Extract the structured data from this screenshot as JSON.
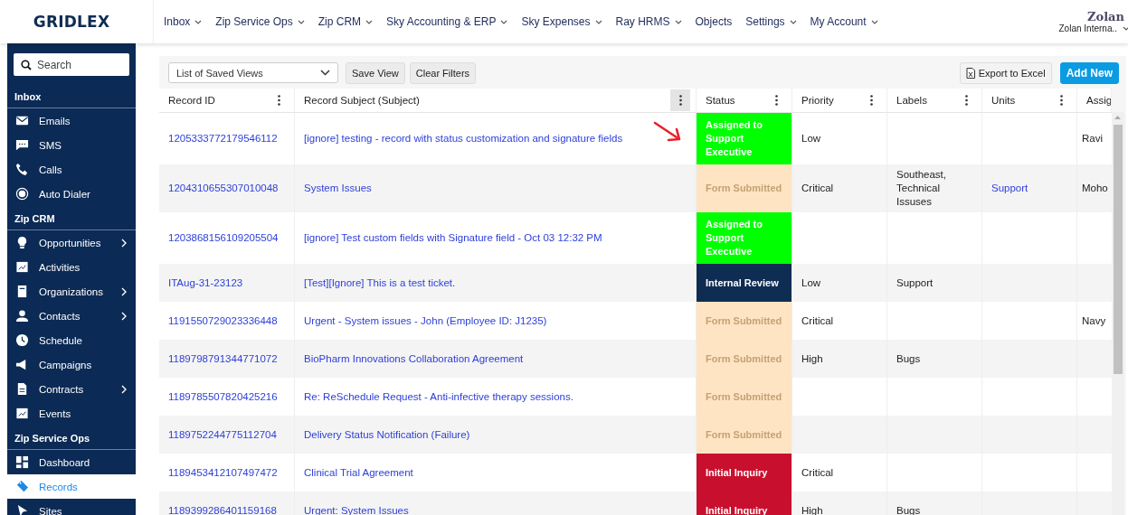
{
  "logo": "GRIDLEX",
  "nav": [
    {
      "label": "Inbox",
      "dropdown": true
    },
    {
      "label": "Zip Service Ops",
      "dropdown": true
    },
    {
      "label": "Zip CRM",
      "dropdown": true
    },
    {
      "label": "Sky Accounting & ERP",
      "dropdown": true
    },
    {
      "label": "Sky Expenses",
      "dropdown": true
    },
    {
      "label": "Ray HRMS",
      "dropdown": true
    },
    {
      "label": "Objects",
      "dropdown": false
    },
    {
      "label": "Settings",
      "dropdown": true
    },
    {
      "label": "My Account",
      "dropdown": true
    }
  ],
  "account": {
    "company": "Zolan",
    "user": "Zolan Interna.."
  },
  "sidebar": {
    "search": {
      "placeholder": "Search"
    },
    "sections": [
      {
        "title": "Inbox",
        "items": [
          {
            "label": "Emails",
            "submenu": false,
            "selected": false
          },
          {
            "label": "SMS",
            "submenu": false,
            "selected": false
          },
          {
            "label": "Calls",
            "submenu": false,
            "selected": false
          },
          {
            "label": "Auto Dialer",
            "submenu": false,
            "selected": false
          }
        ]
      },
      {
        "title": "Zip CRM",
        "items": [
          {
            "label": "Opportunities",
            "submenu": true,
            "selected": false
          },
          {
            "label": "Activities",
            "submenu": false,
            "selected": false
          },
          {
            "label": "Organizations",
            "submenu": true,
            "selected": false
          },
          {
            "label": "Contacts",
            "submenu": true,
            "selected": false
          },
          {
            "label": "Schedule",
            "submenu": false,
            "selected": false
          },
          {
            "label": "Campaigns",
            "submenu": false,
            "selected": false
          },
          {
            "label": "Contracts",
            "submenu": true,
            "selected": false
          },
          {
            "label": "Events",
            "submenu": false,
            "selected": false
          }
        ]
      },
      {
        "title": "Zip Service Ops",
        "items": [
          {
            "label": "Dashboard",
            "submenu": false,
            "selected": false
          },
          {
            "label": "Records",
            "submenu": false,
            "selected": true
          },
          {
            "label": "Sites",
            "submenu": false,
            "selected": false
          }
        ]
      }
    ]
  },
  "toolbar": {
    "saved_views": {
      "value": "List of Saved Views"
    },
    "buttons": [
      "Save View",
      "Clear Filters"
    ],
    "export": "Export to Excel",
    "add_new": "Add New"
  },
  "table": {
    "columns": [
      {
        "label": "Record ID",
        "menu_highlighted": false
      },
      {
        "label": "Record Subject (Subject)",
        "menu_highlighted": true
      },
      {
        "label": "Status",
        "menu_highlighted": false
      },
      {
        "label": "Priority",
        "menu_highlighted": false
      },
      {
        "label": "Labels",
        "menu_highlighted": false
      },
      {
        "label": "Units",
        "menu_highlighted": false
      },
      {
        "label": "Assig"
      }
    ],
    "rows": [
      {
        "record_id": "1205333772179546112",
        "subject": "[ignore] testing - record with status customization and signature fields",
        "status": {
          "label": "Assigned to Support Executive",
          "color": "#00ff00"
        },
        "priority": "Low",
        "labels": "",
        "units": "",
        "assignee": "Ravi"
      },
      {
        "record_id": "1204310655307010048",
        "subject": "System Issues",
        "status": {
          "label": "Form Submitted",
          "color": "#ffe4c4"
        },
        "priority": "Critical",
        "labels": "Southeast, Technical Issuses",
        "units": "Support",
        "assignee": "Moho"
      },
      {
        "record_id": "1203868156109205504",
        "subject": "[ignore] Test custom fields with Signature field - Oct 03 12:32 PM",
        "status": {
          "label": "Assigned to Support Executive",
          "color": "#00ff00"
        },
        "priority": "",
        "labels": "",
        "units": "",
        "assignee": ""
      },
      {
        "record_id": "ITAug-31-23123",
        "subject": "[Test][Ignore] This is a test ticket.",
        "status": {
          "label": "Internal Review",
          "color": "#0f2d52"
        },
        "priority": "Low",
        "labels": "Support",
        "units": "",
        "assignee": ""
      },
      {
        "record_id": "1191550729023336448",
        "subject": "Urgent - System issues - John (Employee ID: J1235)",
        "status": {
          "label": "Form Submitted",
          "color": "#ffe4c4"
        },
        "priority": "Critical",
        "labels": "",
        "units": "",
        "assignee": "Navy"
      },
      {
        "record_id": "1189798791344771072",
        "subject": "BioPharm Innovations Collaboration Agreement",
        "status": {
          "label": "Form Submitted",
          "color": "#ffe4c4"
        },
        "priority": "High",
        "labels": "Bugs",
        "units": "",
        "assignee": ""
      },
      {
        "record_id": "1189785507820425216",
        "subject": "Re: ReSchedule Request - Anti-infective therapy sessions.",
        "status": {
          "label": "Form Submitted",
          "color": "#ffe4c4"
        },
        "priority": "",
        "labels": "",
        "units": "",
        "assignee": ""
      },
      {
        "record_id": "1189752244775112704",
        "subject": "Delivery Status Notification (Failure)",
        "status": {
          "label": "Form Submitted",
          "color": "#ffe4c4"
        },
        "priority": "",
        "labels": "",
        "units": "",
        "assignee": ""
      },
      {
        "record_id": "1189453412107497472",
        "subject": "Clinical Trial Agreement",
        "status": {
          "label": "Initial Inquiry",
          "color": "#c8102e"
        },
        "priority": "Critical",
        "labels": "",
        "units": "",
        "assignee": ""
      },
      {
        "record_id": "1189399286401159168",
        "subject": "Urgent: System Issues",
        "status": {
          "label": "Initial Inquiry",
          "color": "#c8102e"
        },
        "priority": "High",
        "labels": "Bugs",
        "units": "",
        "assignee": ""
      }
    ]
  }
}
